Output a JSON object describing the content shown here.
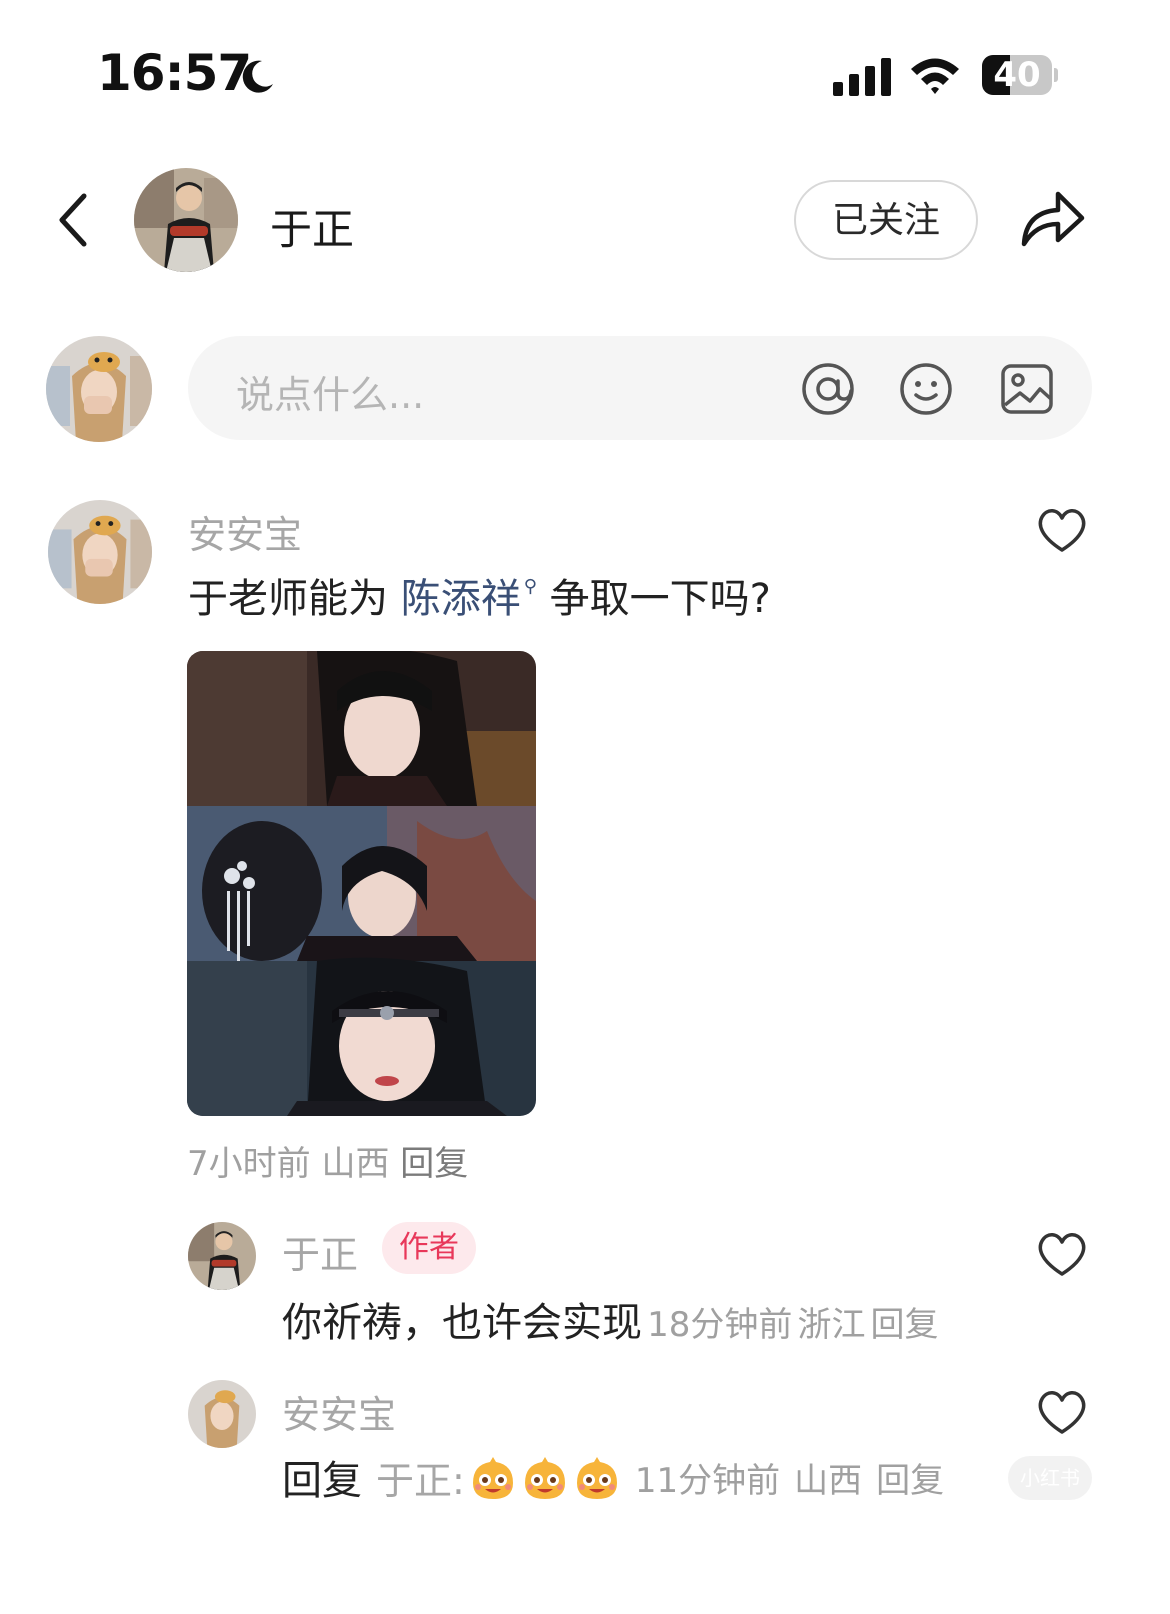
{
  "status_bar": {
    "time": "16:57",
    "battery_level": "40",
    "battery_fraction": 0.4
  },
  "header": {
    "name": "于正",
    "follow_label": "已关注"
  },
  "composer": {
    "placeholder": "说点什么..."
  },
  "comment": {
    "username": "安安宝",
    "text_before": "于老师能为 ",
    "mention": "陈添祥",
    "text_after": " 争取一下吗?",
    "time": "7小时前",
    "location": "山西",
    "reply_label": "回复"
  },
  "replies": [
    {
      "username": "于正",
      "badge": "作者",
      "text": "你祈祷，也许会实现",
      "time": "18分钟前",
      "location": "浙江",
      "reply_label": "回复"
    },
    {
      "username": "安安宝",
      "reply_prefix": "回复",
      "reply_to": "于正:",
      "time": "11分钟前",
      "location": "山西",
      "reply_label": "回复",
      "stickers": [
        "laughing-sticker",
        "laughing-sticker",
        "laughing-sticker"
      ]
    }
  ],
  "watermark": "小红书",
  "colors": {
    "accent_red": "#e8385a",
    "mention_blue": "#3a4f76",
    "muted_gray": "#a6a6a6"
  }
}
